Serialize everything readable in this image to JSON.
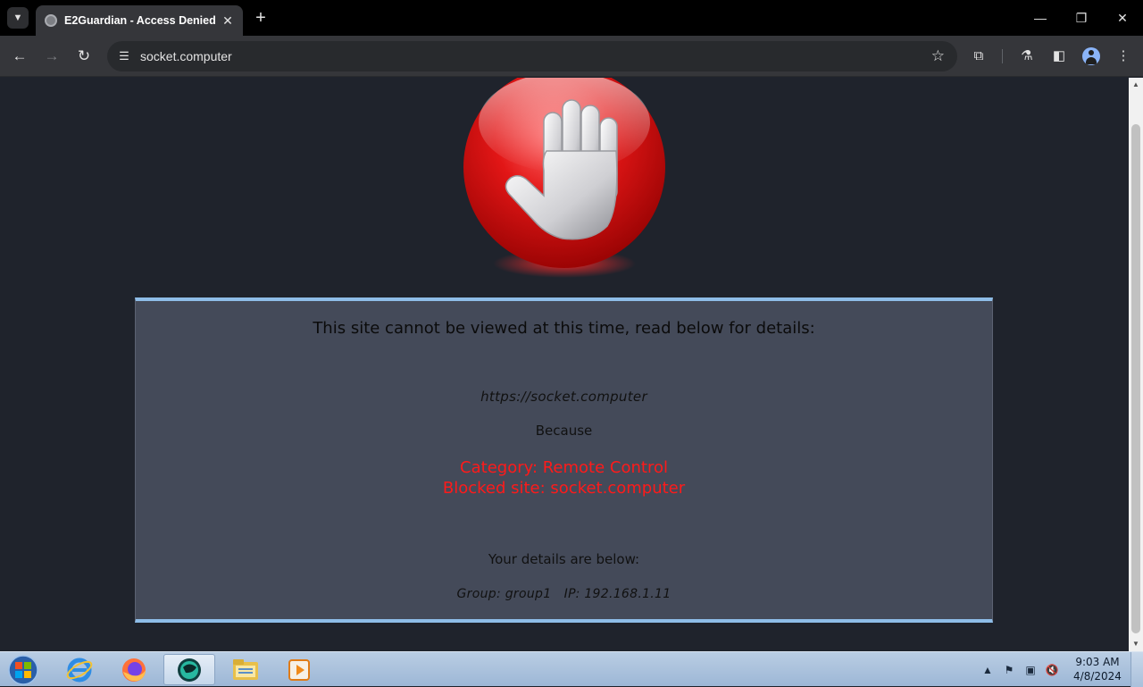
{
  "browser": {
    "tab": {
      "title": "E2Guardian - Access Denied",
      "close_icon": "close-icon"
    },
    "new_tab_label": "+",
    "window_controls": {
      "minimize": "—",
      "restore": "❐",
      "close": "✕"
    },
    "address_bar": {
      "url": "socket.computer"
    }
  },
  "page": {
    "heading": "This site cannot be viewed at this time, read below for details:",
    "blocked_url": "https://socket.computer",
    "because_label": "Because",
    "reason_category": "Category: Remote Control",
    "reason_blocked": "Blocked site: socket.computer",
    "details_heading": "Your details are below:",
    "details_line": "Group: group1   IP: 192.168.1.11",
    "colors": {
      "panel_bg": "#444a59",
      "panel_border": "#8ebde8",
      "reason": "#ff1a1a",
      "page_bg": "#1f232c"
    }
  },
  "taskbar": {
    "apps": [
      "internet-explorer",
      "firefox",
      "remote-desktop-app",
      "file-explorer",
      "media-player"
    ],
    "clock": {
      "time": "9:03 AM",
      "date": "4/8/2024"
    }
  }
}
